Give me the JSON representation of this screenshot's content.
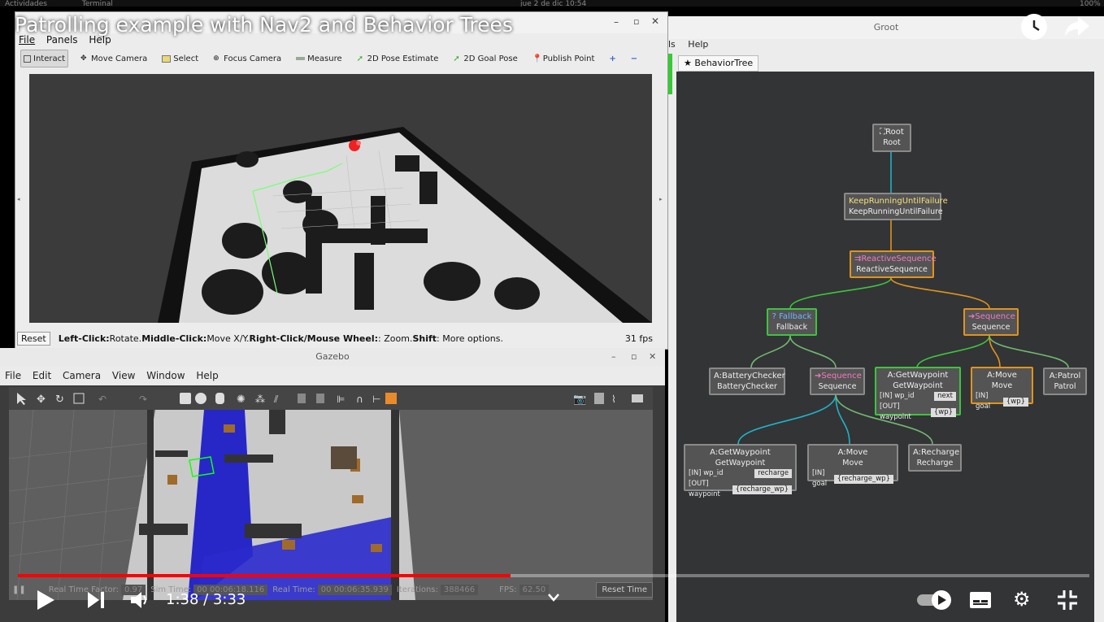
{
  "system_bar": {
    "left": "Actividades",
    "terminal": "Terminal",
    "clock": "jue 2 de dic 10:54",
    "battery": "100%"
  },
  "video": {
    "title": "Patrolling example with Nav2 and Behavior Trees",
    "time_current": "1:38",
    "time_total": "3:33",
    "time_display": "1:38 / 3:33",
    "progress": 0.46
  },
  "rviz": {
    "menu": [
      "File",
      "Panels",
      "Help"
    ],
    "tools": [
      "Interact",
      "Move Camera",
      "Select",
      "Focus Camera",
      "Measure",
      "2D Pose Estimate",
      "2D Goal Pose",
      "Publish Point"
    ],
    "status": {
      "reset": "Reset",
      "b1": "Left-Click:",
      "t1": " Rotate. ",
      "b2": "Middle-Click:",
      "t2": " Move X/Y. ",
      "b3": "Right-Click/Mouse Wheel:",
      "t3": ": Zoom. ",
      "b4": "Shift",
      "t4": ": More options.",
      "fps": "31 fps"
    }
  },
  "gazebo": {
    "title": "Gazebo",
    "menu": [
      "File",
      "Edit",
      "Camera",
      "View",
      "Window",
      "Help"
    ],
    "bottom": {
      "rtf_label": "Real Time Factor:",
      "rtf": "0.97",
      "sim_label": "Sim Time:",
      "sim": "00 00:06:18.116",
      "real_label": "Real Time:",
      "real": "00 00:06:35.939",
      "iter_label": "Iterations:",
      "iter": "388466",
      "fps_label": "FPS:",
      "fps": "62.50",
      "reset_time": "Reset Time"
    }
  },
  "groot": {
    "title": "Groot",
    "menu_partial": "ls",
    "menu_help": "Help",
    "tab": "BehaviorTree",
    "nodes": {
      "root": {
        "type": "Root",
        "name": "Root"
      },
      "kruf": {
        "type": "KeepRunningUntilFailure",
        "name": "KeepRunningUntilFailure"
      },
      "rseq": {
        "type": "ReactiveSequence",
        "name": "ReactiveSequence"
      },
      "fallback": {
        "type": "Fallback",
        "name": "Fallback"
      },
      "seq1": {
        "type": "Sequence",
        "name": "Sequence"
      },
      "battery": {
        "type": "BatteryChecker",
        "name": "BatteryChecker",
        "prefix": "A:"
      },
      "seq2": {
        "type": "Sequence",
        "name": "Sequence"
      },
      "getwp": {
        "type": "GetWaypoint",
        "name": "GetWaypoint",
        "prefix": "A:",
        "in_label": "[IN] wp_id",
        "in_val": "next",
        "out_label": "[OUT] waypoint",
        "out_val": "{wp}"
      },
      "move": {
        "type": "Move",
        "name": "Move",
        "prefix": "A:",
        "in_label": "[IN] goal",
        "in_val": "{wp}"
      },
      "patrol": {
        "type": "Patrol",
        "name": "Patrol",
        "prefix": "A:"
      },
      "getwp2": {
        "type": "GetWaypoint",
        "name": "GetWaypoint",
        "prefix": "A:",
        "in_label": "[IN] wp_id",
        "in_val": "recharge",
        "out_label": "[OUT] waypoint",
        "out_val": "{recharge_wp}"
      },
      "move2": {
        "type": "Move",
        "name": "Move",
        "prefix": "A:",
        "in_label": "[IN] goal",
        "in_val": "{recharge_wp}"
      },
      "recharge": {
        "type": "Recharge",
        "name": "Recharge",
        "prefix": "A:"
      }
    }
  },
  "colors": {
    "accent_red": "#ff0000",
    "success_green": "#3ec43e",
    "running_orange": "#e0941c",
    "idle_gray": "#8a8a8a"
  }
}
